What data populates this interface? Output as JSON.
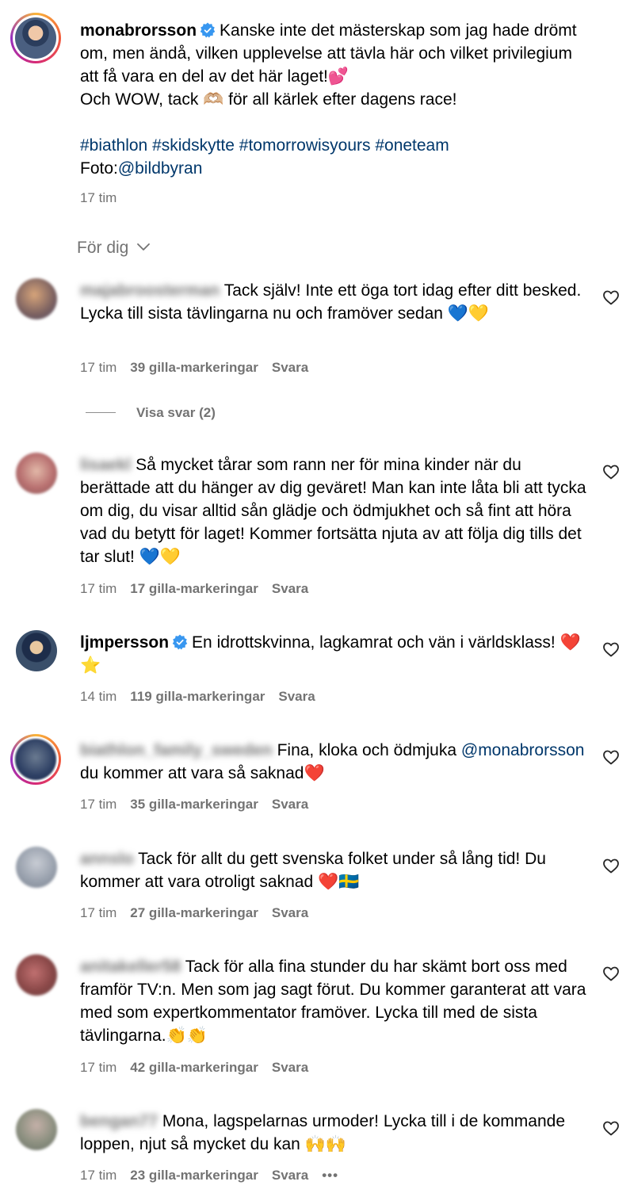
{
  "post": {
    "username": "monabrorsson",
    "caption_1": "Kanske inte det mästerskap som jag hade drömt om, men ändå, vilken upplevelse att tävla här och vilket privilegium att få vara en del av det här laget!💕",
    "caption_2": "Och WOW, tack 🫶🏼 för all kärlek efter dagens race!",
    "hashtags": "#biathlon #skidskytte #tomorrowisyours #oneteam",
    "photo_label": "Foto:",
    "photo_credit": "@bildbyran",
    "time": "17 tim"
  },
  "filter": {
    "label": "För dig"
  },
  "comments": [
    {
      "username": "majabroosterman",
      "text": "Tack själv! Inte ett öga tort idag efter ditt besked. Lycka till sista tävlingarna nu och framöver sedan 💙💛",
      "time": "17 tim",
      "likes": "39 gilla-markeringar",
      "reply": "Svara"
    },
    {
      "username": "lisaekl",
      "text": "Så mycket tårar som rann ner för mina kinder när du berättade att du hänger av dig geväret! Man kan inte låta bli att tycka om dig, du visar alltid sån glädje och ödmjukhet och så fint att höra vad du betytt för laget! Kommer fortsätta njuta av att följa dig tills det tar slut! 💙💛",
      "time": "17 tim",
      "likes": "17 gilla-markeringar",
      "reply": "Svara"
    },
    {
      "username": "ljmpersson",
      "text": "En idrottskvinna, lagkamrat och vän i världsklass! ❤️ ⭐",
      "time": "14 tim",
      "likes": "119 gilla-markeringar",
      "reply": "Svara"
    },
    {
      "username": "biathlon_family_sweden",
      "text_pre": "Fina, kloka och ödmjuka ",
      "mention": "@monabrorsson",
      "text_post": " du kommer att vara så saknad❤️",
      "time": "17 tim",
      "likes": "35 gilla-markeringar",
      "reply": "Svara"
    },
    {
      "username": "annslo",
      "text": "Tack för allt du gett svenska folket under så lång tid! Du kommer att vara otroligt saknad ❤️🇸🇪",
      "time": "17 tim",
      "likes": "27 gilla-markeringar",
      "reply": "Svara"
    },
    {
      "username": "anitakeller58",
      "text": "Tack för alla fina stunder du har skämt bort oss med framför TV:n. Men som jag sagt förut. Du kommer garanterat att vara med som expertkommentator framöver. Lycka till med de sista tävlingarna.👏👏",
      "time": "17 tim",
      "likes": "42 gilla-markeringar",
      "reply": "Svara"
    },
    {
      "username": "bengan77",
      "text": "Mona, lagspelarnas urmoder! Lycka till i de kommande loppen, njut så mycket du kan 🙌🙌",
      "time": "17 tim",
      "likes": "23 gilla-markeringar",
      "reply": "Svara"
    }
  ],
  "view_replies": "Visa svar (2)",
  "more": "•••",
  "colors": {
    "link": "#00376b",
    "meta": "#737373",
    "verified": "#3897f0"
  }
}
